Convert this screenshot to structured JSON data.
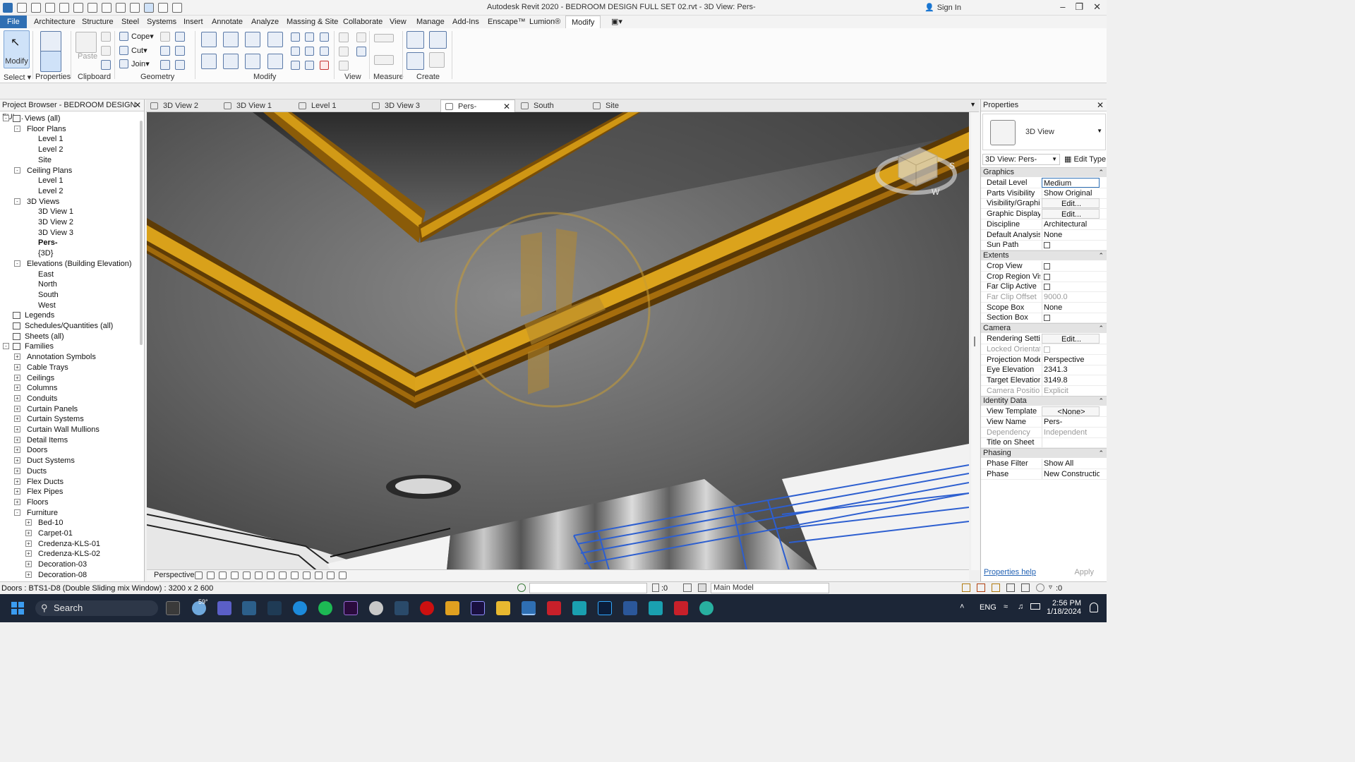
{
  "window": {
    "title": "Autodesk Revit 2020 - BEDROOM DESIGN FULL SET 02.rvt - 3D View: Pers-",
    "sign_in": "Sign In",
    "minimize": "–",
    "restore": "❐",
    "close": "✕"
  },
  "menu": {
    "file": "File",
    "tabs": [
      "Architecture",
      "Structure",
      "Steel",
      "Systems",
      "Insert",
      "Annotate",
      "Analyze",
      "Massing & Site",
      "Collaborate",
      "View",
      "Manage",
      "Add-Ins",
      "Enscape™",
      "Lumion®",
      "Modify"
    ]
  },
  "ribbon": {
    "modify": "Modify",
    "properties": "Properties",
    "paste": "Paste",
    "cope": "Cope",
    "cut": "Cut",
    "join": "Join",
    "panels": {
      "select": "Select",
      "properties": "Properties",
      "clipboard": "Clipboard",
      "geometry": "Geometry",
      "modify": "Modify",
      "view": "View",
      "measure": "Measure",
      "create": "Create"
    }
  },
  "project_browser": {
    "title": "Project Browser - BEDROOM DESIGN FUL...",
    "close": "✕",
    "items": [
      {
        "label": "Views (all)",
        "toggle": "-"
      },
      {
        "label": "Floor Plans",
        "toggle": "-"
      },
      {
        "label": "Level 1"
      },
      {
        "label": "Level 2"
      },
      {
        "label": "Site"
      },
      {
        "label": "Ceiling Plans",
        "toggle": "-"
      },
      {
        "label": "Level 1"
      },
      {
        "label": "Level 2"
      },
      {
        "label": "3D Views",
        "toggle": "-"
      },
      {
        "label": "3D View 1"
      },
      {
        "label": "3D View 2"
      },
      {
        "label": "3D View 3"
      },
      {
        "label": "Pers-"
      },
      {
        "label": "{3D}"
      },
      {
        "label": "Elevations (Building Elevation)",
        "toggle": "-"
      },
      {
        "label": "East"
      },
      {
        "label": "North"
      },
      {
        "label": "South"
      },
      {
        "label": "West"
      },
      {
        "label": "Legends"
      },
      {
        "label": "Schedules/Quantities (all)"
      },
      {
        "label": "Sheets (all)"
      },
      {
        "label": "Families",
        "toggle": "-"
      },
      {
        "label": "Annotation Symbols",
        "toggle": "+"
      },
      {
        "label": "Cable Trays",
        "toggle": "+"
      },
      {
        "label": "Ceilings",
        "toggle": "+"
      },
      {
        "label": "Columns",
        "toggle": "+"
      },
      {
        "label": "Conduits",
        "toggle": "+"
      },
      {
        "label": "Curtain Panels",
        "toggle": "+"
      },
      {
        "label": "Curtain Systems",
        "toggle": "+"
      },
      {
        "label": "Curtain Wall Mullions",
        "toggle": "+"
      },
      {
        "label": "Detail Items",
        "toggle": "+"
      },
      {
        "label": "Doors",
        "toggle": "+"
      },
      {
        "label": "Duct Systems",
        "toggle": "+"
      },
      {
        "label": "Ducts",
        "toggle": "+"
      },
      {
        "label": "Flex Ducts",
        "toggle": "+"
      },
      {
        "label": "Flex Pipes",
        "toggle": "+"
      },
      {
        "label": "Floors",
        "toggle": "+"
      },
      {
        "label": "Furniture",
        "toggle": "-"
      },
      {
        "label": "Bed-10",
        "toggle": "+"
      },
      {
        "label": "Carpet-01",
        "toggle": "+"
      },
      {
        "label": "Credenza-KLS-01",
        "toggle": "+"
      },
      {
        "label": "Credenza-KLS-02",
        "toggle": "+"
      },
      {
        "label": "Decoration-03",
        "toggle": "+"
      },
      {
        "label": "Decoration-08",
        "toggle": "+"
      }
    ]
  },
  "view_tabs": [
    "3D View 2",
    "3D View 1",
    "Level 1",
    "3D View 3",
    "Pers-",
    "South",
    "Site"
  ],
  "view_tab_close": "✕",
  "viewport": {
    "mode": "Perspective",
    "viewcube_labels": [
      "S",
      "W"
    ]
  },
  "properties": {
    "title": "Properties",
    "close": "✕",
    "type_name": "3D View",
    "selector": "3D View: Pers-",
    "edit_type": "Edit Type",
    "groups": [
      {
        "name": "Graphics",
        "rows": [
          {
            "k": "Detail Level",
            "v": "Medium"
          },
          {
            "k": "Parts Visibility",
            "v": "Show Original"
          },
          {
            "k": "Visibility/Graphi...",
            "v": "Edit..."
          },
          {
            "k": "Graphic Display...",
            "v": "Edit..."
          },
          {
            "k": "Discipline",
            "v": "Architectural"
          },
          {
            "k": "Default Analysis...",
            "v": "None"
          },
          {
            "k": "Sun Path",
            "v": ""
          }
        ]
      },
      {
        "name": "Extents",
        "rows": [
          {
            "k": "Crop View",
            "v": ""
          },
          {
            "k": "Crop Region Vis...",
            "v": ""
          },
          {
            "k": "Far Clip Active",
            "v": ""
          },
          {
            "k": "Far Clip Offset",
            "v": "9000.0"
          },
          {
            "k": "Scope Box",
            "v": "None"
          },
          {
            "k": "Section Box",
            "v": ""
          }
        ]
      },
      {
        "name": "Camera",
        "rows": [
          {
            "k": "Rendering Setti...",
            "v": "Edit..."
          },
          {
            "k": "Locked Orientat...",
            "v": ""
          },
          {
            "k": "Projection Mode",
            "v": "Perspective"
          },
          {
            "k": "Eye Elevation",
            "v": "2341.3"
          },
          {
            "k": "Target Elevation",
            "v": "3149.8"
          },
          {
            "k": "Camera Position",
            "v": "Explicit"
          }
        ]
      },
      {
        "name": "Identity Data",
        "rows": [
          {
            "k": "View Template",
            "v": "<None>"
          },
          {
            "k": "View Name",
            "v": "Pers-"
          },
          {
            "k": "Dependency",
            "v": "Independent"
          },
          {
            "k": "Title on Sheet",
            "v": ""
          }
        ]
      },
      {
        "name": "Phasing",
        "rows": [
          {
            "k": "Phase Filter",
            "v": "Show All"
          },
          {
            "k": "Phase",
            "v": "New Construction"
          }
        ]
      }
    ],
    "help": "Properties help",
    "apply": "Apply"
  },
  "statusbar": {
    "text": "Doors : BTS1-D8 (Double Sliding mix Window) : 3200 x 2 600",
    "model": "Main Model",
    "sel_count": ":0",
    "filter_count": ":0"
  },
  "taskbar": {
    "search": "Search",
    "weather": "59°",
    "lang": "ENG",
    "time": "2:56 PM",
    "date": "1/18/2024"
  },
  "colors": {
    "file_tab": "#2f6fb3",
    "molding": "#c98f12",
    "ceiling": "#5e5e5e",
    "selection_blue": "#2d5fd0",
    "taskbar": "#1c2637"
  }
}
